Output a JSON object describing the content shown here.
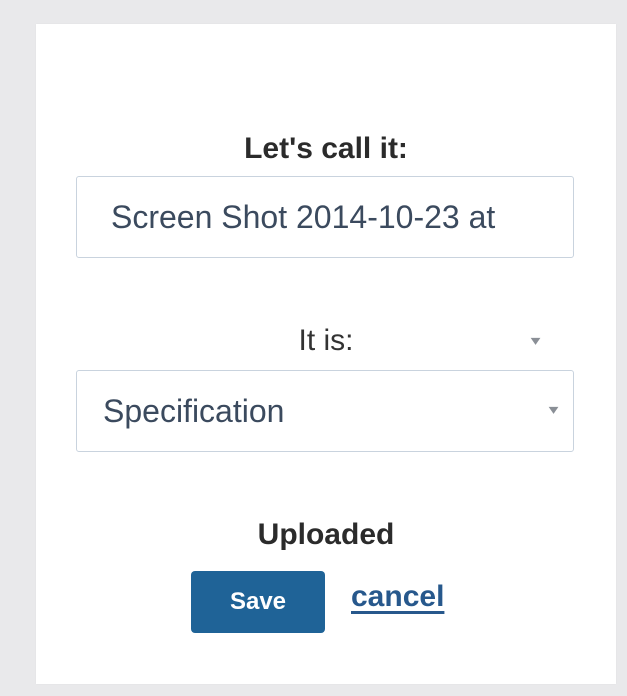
{
  "form": {
    "name_label": "Let's call it:",
    "name_value": "Screen Shot 2014-10-23 at",
    "type_label": "It is:",
    "type_selected": "Specification",
    "status_text": "Uploaded",
    "save_label": "Save",
    "cancel_label": "cancel"
  },
  "icons": {
    "dropdown_caret": "chevron-down-icon",
    "caret_glyph": "▾"
  },
  "colors": {
    "background": "#e9e9eb",
    "panel": "#ffffff",
    "primary_button": "#1f6397",
    "link": "#27588c",
    "input_border": "#c9d3de",
    "input_text": "#3b4a5e"
  }
}
